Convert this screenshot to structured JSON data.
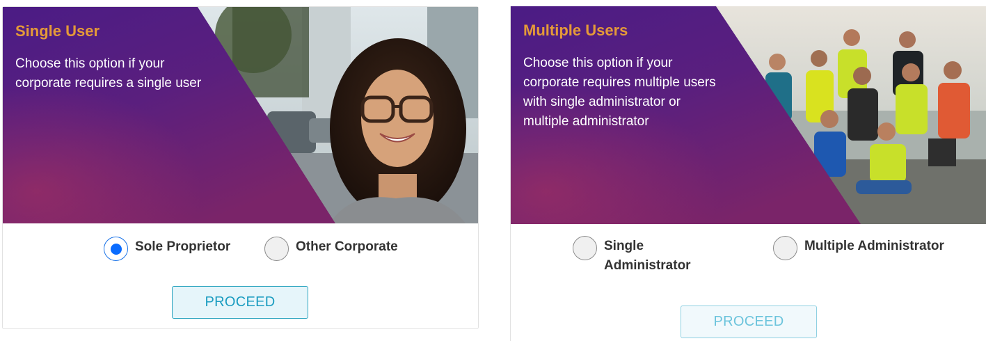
{
  "single_user": {
    "title": "Single User",
    "description_line1": "Choose this option if your",
    "description_line2": "corporate requires a single user",
    "options": [
      {
        "label": "Sole Proprietor",
        "selected": true
      },
      {
        "label": "Other Corporate",
        "selected": false
      }
    ],
    "proceed_label": "PROCEED"
  },
  "multiple_users": {
    "title": "Multiple Users",
    "description_line1": "Choose this option if your",
    "description_line2": "corporate requires multiple users",
    "description_line3": "with single administrator or",
    "description_line4": "multiple administrator",
    "options": [
      {
        "label_line1": "Single",
        "label_line2": "Administrator",
        "selected": false
      },
      {
        "label": "Multiple Administrator",
        "selected": false
      }
    ],
    "proceed_label": "PROCEED"
  },
  "colors": {
    "title_accent": "#e59a38",
    "overlay_purple": "#4a1580",
    "radio_selected": "#0a6cff",
    "proceed_text": "#1a9cc0"
  }
}
